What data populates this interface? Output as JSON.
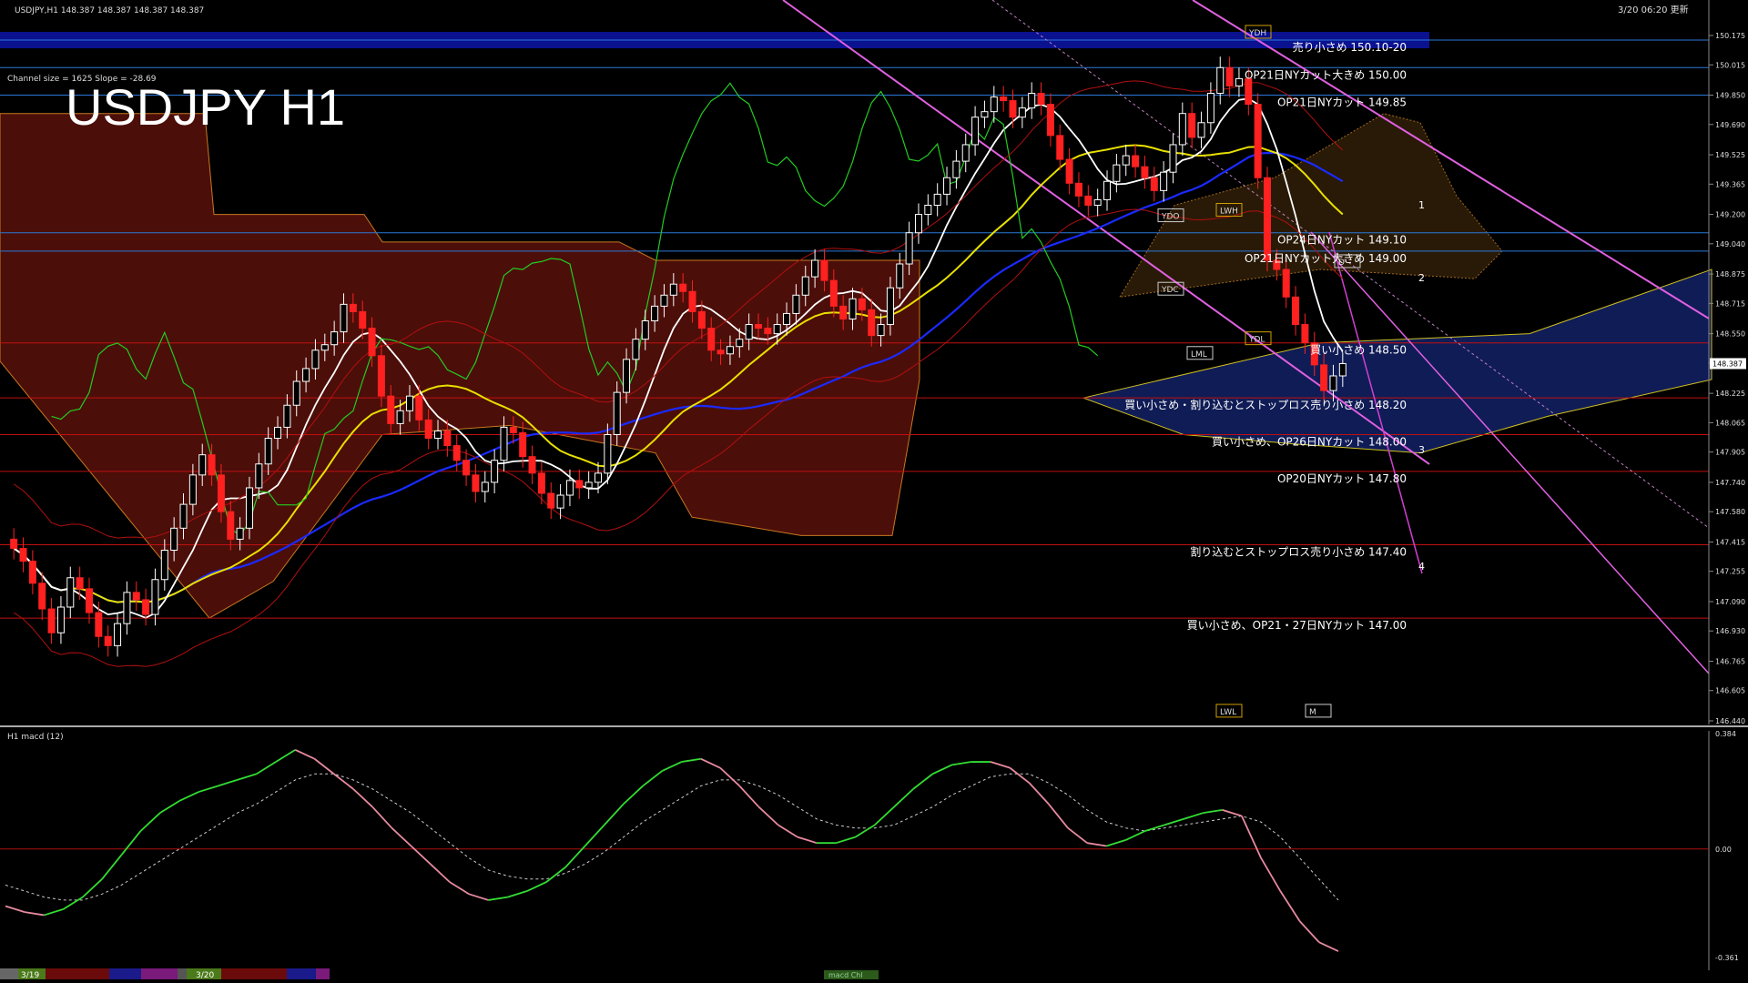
{
  "window": {
    "symbol_info": "USDJPY,H1  148.387 148.387 148.387 148.387",
    "timestamp": "3/20 06:20 更新"
  },
  "title": "USDJPY H1",
  "channel_info": "Channel size = 1625 Slope = -28.69",
  "macd_label": "H1  macd (12)",
  "bottom_tabs": [
    "3/19",
    "3/20",
    "macd Chl"
  ],
  "colors": {
    "background": "#000000",
    "up_candle": "#ffffff",
    "down_candle": "#ff2020",
    "ma_white": "#ffffff",
    "ma_yellow": "#e8e000",
    "ma_blue": "#1a2aff",
    "chikou": "#22cc22",
    "channel": "#e060e0",
    "level_red": "#c01010",
    "level_blue": "#2a78d8",
    "kumo_bull": "#1b2f8f",
    "kumo_bear": "#8b1a10",
    "macd_up": "#33dd33",
    "macd_down": "#e78aa0",
    "highlight_band": "#0a1290"
  },
  "chart_data": [
    {
      "type": "line",
      "panel": "price",
      "title": "USDJPY H1",
      "xlabel": "",
      "ylabel": "",
      "ylim": [
        146.44,
        150.18
      ],
      "y_ticks": [
        "150.175",
        "150.015",
        "149.850",
        "149.690",
        "149.525",
        "149.365",
        "149.200",
        "149.040",
        "148.875",
        "148.715",
        "148.550",
        "148.390",
        "148.225",
        "148.065",
        "147.905",
        "147.740",
        "147.580",
        "147.415",
        "147.255",
        "147.090",
        "146.930",
        "146.765",
        "146.605",
        "146.440"
      ],
      "current_price_label": "148.387",
      "current_price": 148.387,
      "levels": [
        {
          "price": 150.15,
          "text": "売り小さめ 150.10-20",
          "color": "#2a78d8",
          "band": true
        },
        {
          "price": 150.0,
          "text": "OP21日NYカット大きめ 150.00",
          "color": "#2a78d8"
        },
        {
          "price": 149.85,
          "text": "OP21日NYカット 149.85",
          "color": "#2a78d8"
        },
        {
          "price": 149.1,
          "text": "OP24日NYカット 149.10",
          "color": "#2a78d8"
        },
        {
          "price": 149.0,
          "text": "OP21日NYカット大きめ 149.00",
          "color": "#2a78d8"
        },
        {
          "price": 148.5,
          "text": "買い小さめ 148.50",
          "color": "#c01010"
        },
        {
          "price": 148.2,
          "text": "買い小さめ・割り込むとストップロス売り小さめ 148.20",
          "color": "#c01010"
        },
        {
          "price": 148.0,
          "text": "買い小さめ、OP26日NYカット 148.00",
          "color": "#c01010"
        },
        {
          "price": 147.8,
          "text": "OP20日NYカット 147.80",
          "color": "#c01010"
        },
        {
          "price": 147.4,
          "text": "割り込むとストップロス売り小さめ 147.40",
          "color": "#c01010"
        },
        {
          "price": 147.0,
          "text": "買い小さめ、OP21・27日NYカット 147.00",
          "color": "#c01010"
        }
      ],
      "markers": [
        {
          "text": "YDH",
          "price": 150.2
        },
        {
          "text": "YDO",
          "price": 149.2
        },
        {
          "text": "YDC",
          "price": 148.8
        },
        {
          "text": "YDL",
          "price": 148.53
        },
        {
          "text": "LML",
          "price": 148.45
        },
        {
          "text": "LWH",
          "price": 149.23
        },
        {
          "text": "LWL",
          "price": 146.5
        },
        {
          "text": "M",
          "price": 146.5
        },
        {
          "text": "D",
          "price": 148.95
        }
      ],
      "wave_labels": [
        "1",
        "2",
        "3",
        "4"
      ],
      "series": [
        {
          "role": "candles",
          "color": "#ffffff",
          "values": [
            147.38,
            147.31,
            147.19,
            147.05,
            146.92,
            147.06,
            147.22,
            147.16,
            147.03,
            146.9,
            146.85,
            146.97,
            147.14,
            147.1,
            147.02,
            147.21,
            147.37,
            147.49,
            147.62,
            147.78,
            147.89,
            147.78,
            147.58,
            147.43,
            147.49,
            147.71,
            147.84,
            147.98,
            148.04,
            148.16,
            148.29,
            148.36,
            148.46,
            148.49,
            148.56,
            148.71,
            148.67,
            148.58,
            148.43,
            148.21,
            148.06,
            148.13,
            148.21,
            148.08,
            147.98,
            148.02,
            147.94,
            147.86,
            147.78,
            147.69,
            147.74,
            147.86,
            148.04,
            148.01,
            147.88,
            147.79,
            147.68,
            147.6,
            147.67,
            147.75,
            147.71,
            147.74,
            147.79,
            148.0,
            148.23,
            148.41,
            148.52,
            148.62,
            148.7,
            148.76,
            148.82,
            148.78,
            148.67,
            148.58,
            148.46,
            148.44,
            148.48,
            148.52,
            148.6,
            148.58,
            148.55,
            148.6,
            148.66,
            148.76,
            148.86,
            148.95,
            148.84,
            148.7,
            148.63,
            148.74,
            148.68,
            148.54,
            148.6,
            148.8,
            148.93,
            149.1,
            149.2,
            149.25,
            149.31,
            149.4,
            149.49,
            149.58,
            149.73,
            149.76,
            149.84,
            149.82,
            149.73,
            149.78,
            149.86,
            149.8,
            149.63,
            149.5,
            149.37,
            149.3,
            149.25,
            149.28,
            149.38,
            149.47,
            149.52,
            149.46,
            149.4,
            149.33,
            149.43,
            149.58,
            149.75,
            149.62,
            149.7,
            149.86,
            150.0,
            149.9,
            149.94,
            149.8,
            149.4,
            148.95,
            148.9,
            148.75,
            148.6,
            148.5,
            148.38,
            148.24,
            148.32,
            148.387
          ]
        },
        {
          "role": "ma-fast",
          "color": "#ffffff"
        },
        {
          "role": "ma-mid",
          "color": "#e8e000"
        },
        {
          "role": "ma-slow",
          "color": "#1a2aff"
        },
        {
          "role": "chikou",
          "color": "#22cc22"
        }
      ]
    },
    {
      "type": "line",
      "panel": "macd",
      "title": "H1  macd (12)",
      "ylim": [
        -0.361,
        0.384
      ],
      "y_ticks": [
        "0.384",
        "0.00",
        "-0.361"
      ],
      "series": [
        {
          "role": "macd",
          "color": "#33dd33",
          "values": [
            -0.19,
            -0.21,
            -0.22,
            -0.2,
            -0.16,
            -0.1,
            -0.02,
            0.06,
            0.12,
            0.16,
            0.19,
            0.21,
            0.23,
            0.25,
            0.29,
            0.33,
            0.3,
            0.25,
            0.2,
            0.14,
            0.07,
            0.01,
            -0.05,
            -0.11,
            -0.15,
            -0.17,
            -0.16,
            -0.14,
            -0.11,
            -0.06,
            0.01,
            0.08,
            0.15,
            0.21,
            0.26,
            0.29,
            0.3,
            0.27,
            0.21,
            0.14,
            0.08,
            0.04,
            0.02,
            0.02,
            0.04,
            0.08,
            0.14,
            0.2,
            0.25,
            0.28,
            0.29,
            0.29,
            0.27,
            0.22,
            0.15,
            0.07,
            0.02,
            0.01,
            0.03,
            0.06,
            0.08,
            0.1,
            0.12,
            0.13,
            0.11,
            -0.03,
            -0.14,
            -0.24,
            -0.31,
            -0.34
          ]
        },
        {
          "role": "signal",
          "color": "#dddddd",
          "values": [
            -0.12,
            -0.14,
            -0.16,
            -0.17,
            -0.17,
            -0.15,
            -0.12,
            -0.08,
            -0.04,
            0.0,
            0.04,
            0.08,
            0.12,
            0.15,
            0.19,
            0.23,
            0.25,
            0.25,
            0.23,
            0.2,
            0.16,
            0.12,
            0.07,
            0.02,
            -0.03,
            -0.07,
            -0.09,
            -0.1,
            -0.1,
            -0.08,
            -0.05,
            -0.01,
            0.04,
            0.09,
            0.13,
            0.17,
            0.21,
            0.23,
            0.23,
            0.21,
            0.18,
            0.14,
            0.1,
            0.08,
            0.07,
            0.07,
            0.08,
            0.11,
            0.14,
            0.18,
            0.21,
            0.24,
            0.25,
            0.25,
            0.22,
            0.18,
            0.13,
            0.09,
            0.07,
            0.06,
            0.07,
            0.08,
            0.09,
            0.1,
            0.11,
            0.09,
            0.04,
            -0.03,
            -0.1,
            -0.17
          ]
        }
      ]
    }
  ]
}
